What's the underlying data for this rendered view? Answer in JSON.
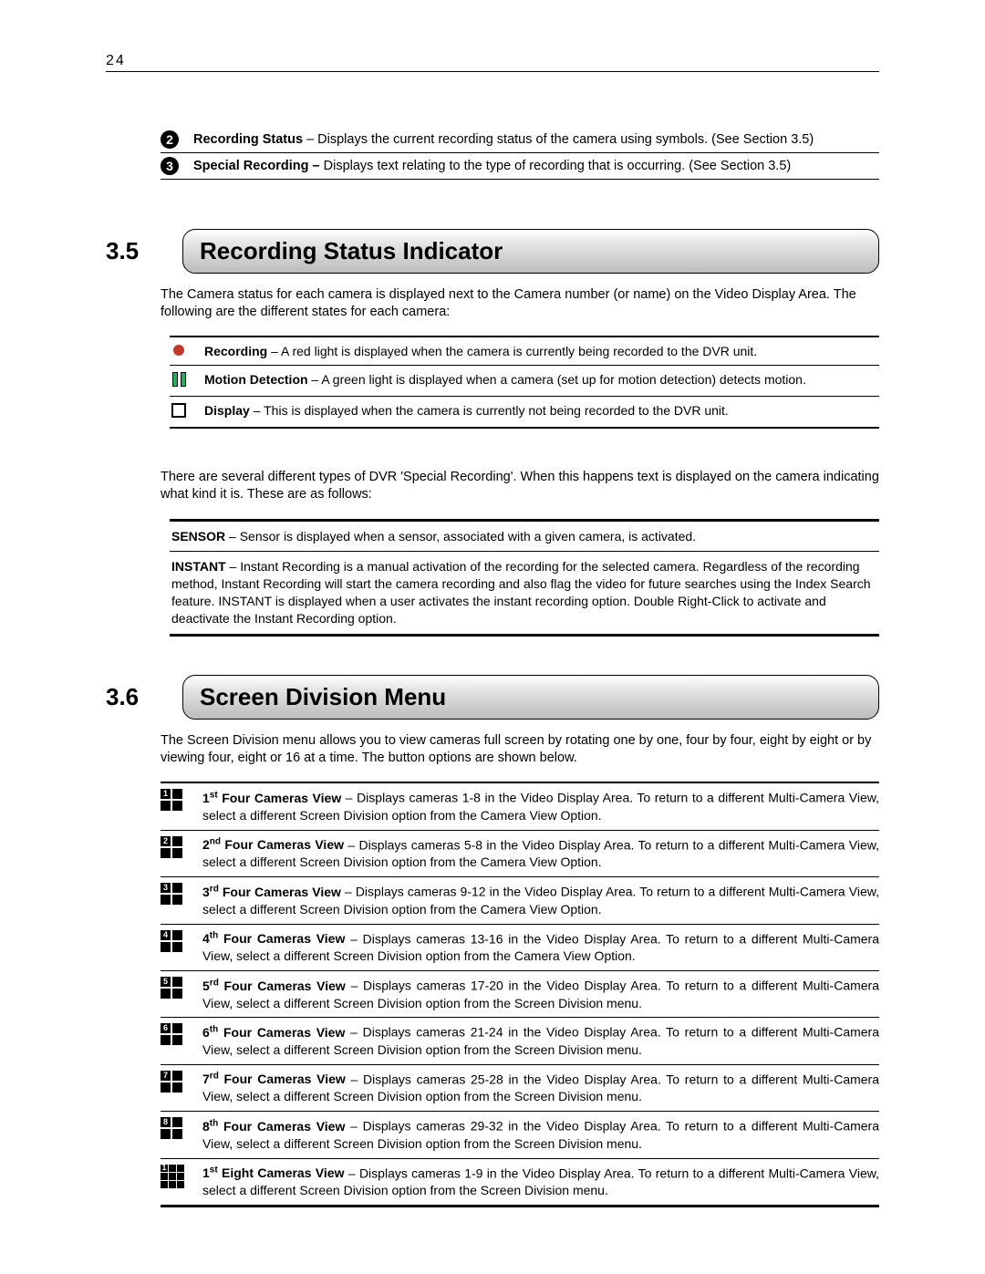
{
  "page_number": "24",
  "intro_rows": [
    {
      "n": "2",
      "bold": "Recording Status",
      "text": " – Displays the current recording status of the camera using symbols. (See Section 3.5)"
    },
    {
      "n": "3",
      "bold": "Special Recording –",
      "text": " Displays text relating to the type of recording that is occurring. (See Section 3.5)"
    }
  ],
  "sec35": {
    "num": "3.5",
    "title": "Recording Status Indicator",
    "para": "The Camera status for each camera is displayed next to the Camera number (or name) on the Video Display Area. The following are the different states for each camera:",
    "rows": [
      {
        "label": "Recording",
        "desc": " – A red light is displayed when the camera is currently being recorded to the DVR unit."
      },
      {
        "label": "Motion Detection",
        "desc": " – A green light is displayed when a camera (set up for motion detection) detects motion."
      },
      {
        "label": "Display",
        "desc": " – This is displayed when the camera is currently not being recorded to the DVR unit."
      }
    ],
    "special_intro": "There are several different types of DVR 'Special Recording'. When this happens text is displayed on the camera indicating what kind it is. These are as follows:",
    "special_rows": [
      {
        "label": "SENSOR",
        "desc": " – Sensor is displayed when a sensor, associated with a given camera, is activated."
      },
      {
        "label": "INSTANT",
        "desc": " – Instant Recording is a manual activation of the recording for the selected camera. Regardless of the recording method, Instant Recording will start the camera recording and also flag the video for future searches using the Index Search feature. INSTANT is displayed when a user activates the instant recording option. Double Right-Click to activate and deactivate the Instant Recording option."
      }
    ]
  },
  "sec36": {
    "num": "3.6",
    "title": "Screen Division Menu",
    "para": "The Screen Division menu allows you to view cameras full screen by rotating one by one, four by four, eight by eight or by viewing four, eight or 16 at a time. The button options are shown below.",
    "rows": [
      {
        "n": "1",
        "ord": "st",
        "title": " Four Cameras View",
        "desc": " – Displays cameras 1-8 in the Video Display Area. To return to a different Multi-Camera View, select a different Screen Division option from the Camera View Option."
      },
      {
        "n": "2",
        "ord": "nd",
        "title": " Four Cameras View",
        "desc": " – Displays cameras 5-8 in the Video Display Area. To return to a different Multi-Camera View, select a different Screen Division option from the Camera View Option."
      },
      {
        "n": "3",
        "ord": "rd",
        "title": " Four Cameras View",
        "desc": " – Displays cameras 9-12 in the Video Display Area. To return to a different Multi-Camera View, select a different Screen Division option from the Camera View Option."
      },
      {
        "n": "4",
        "ord": "th",
        "title": " Four Cameras View",
        "desc": " – Displays cameras 13-16 in the Video Display Area. To return to a different Multi-Camera View, select a different Screen Division option from the Camera View Option."
      },
      {
        "n": "5",
        "ord": "rd",
        "title": " Four Cameras View",
        "desc": " – Displays cameras 17-20 in the Video Display Area. To return to a different Multi-Camera View, select a different Screen Division option from the Screen Division menu."
      },
      {
        "n": "6",
        "ord": "th",
        "title": " Four Cameras View",
        "desc": " – Displays cameras 21-24 in the Video Display Area. To return to a different Multi-Camera View, select a different Screen Division option from the Screen Division menu."
      },
      {
        "n": "7",
        "ord": "rd",
        "title": " Four Cameras View",
        "desc": " – Displays cameras 25-28 in the Video Display Area. To return to a different Multi-Camera View, select a different Screen Division option from the Screen Division menu."
      },
      {
        "n": "8",
        "ord": "th",
        "title": " Four Cameras View",
        "desc": " – Displays cameras 29-32 in the Video Display Area. To return to a different Multi-Camera View, select a different Screen Division option from the Screen Division menu."
      },
      {
        "n": "1",
        "ord": "st",
        "title": " Eight Cameras View",
        "desc": " – Displays cameras 1-9 in the Video Display Area. To return to a different Multi-Camera View, select a different Screen Division option from the Screen Division menu."
      }
    ]
  }
}
